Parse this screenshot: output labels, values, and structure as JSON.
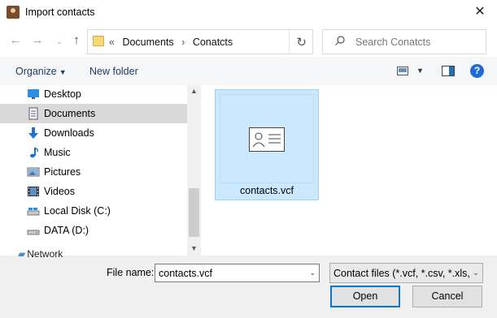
{
  "window": {
    "title": "Import contacts"
  },
  "address": {
    "breadcrumb": [
      "«",
      "Documents",
      "›",
      "Conatcts"
    ]
  },
  "search": {
    "placeholder": "Search Conatcts"
  },
  "toolbar": {
    "organize_label": "Organize",
    "new_folder_label": "New folder"
  },
  "sidebar": {
    "items": [
      {
        "label": "Desktop",
        "icon": "desktop-icon",
        "selected": false
      },
      {
        "label": "Documents",
        "icon": "documents-icon",
        "selected": true
      },
      {
        "label": "Downloads",
        "icon": "downloads-icon",
        "selected": false
      },
      {
        "label": "Music",
        "icon": "music-icon",
        "selected": false
      },
      {
        "label": "Pictures",
        "icon": "pictures-icon",
        "selected": false
      },
      {
        "label": "Videos",
        "icon": "videos-icon",
        "selected": false
      },
      {
        "label": "Local Disk (C:)",
        "icon": "drive-icon",
        "selected": false
      },
      {
        "label": "DATA (D:)",
        "icon": "drive-icon",
        "selected": false
      }
    ],
    "partial_item": "Network"
  },
  "files": [
    {
      "name": "contacts.vcf",
      "icon": "contact-card-icon",
      "selected": true
    }
  ],
  "footer": {
    "file_name_label": "File name:",
    "file_name_value": "contacts.vcf",
    "file_type_value": "Contact files (*.vcf, *.csv, *.xls, *",
    "open_label": "Open",
    "cancel_label": "Cancel"
  },
  "colors": {
    "accent": "#0078d7",
    "selection": "#cce8ff",
    "help": "#1f6bd1"
  }
}
